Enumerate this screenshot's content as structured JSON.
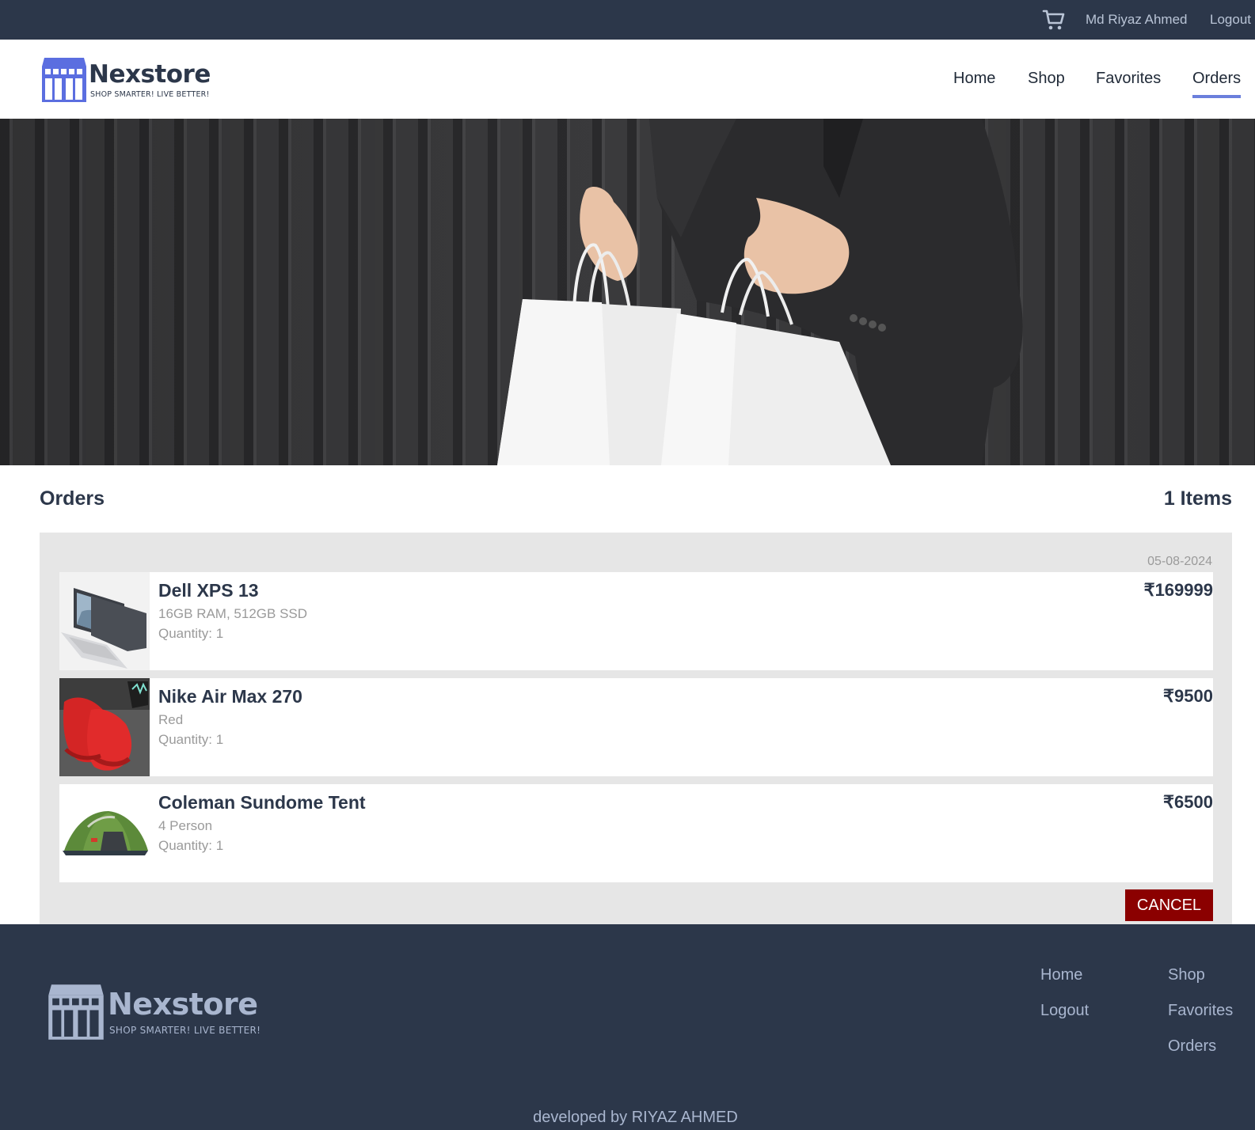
{
  "brand": {
    "name": "Nexstore",
    "tagline": "SHOP SMARTER! LIVE BETTER!"
  },
  "topbar": {
    "cart_icon": "cart-icon",
    "user_name": "Md Riyaz Ahmed",
    "logout_label": "Logout"
  },
  "nav": {
    "items": [
      {
        "label": "Home"
      },
      {
        "label": "Shop"
      },
      {
        "label": "Favorites"
      },
      {
        "label": "Orders",
        "active": true
      }
    ]
  },
  "orders": {
    "title": "Orders",
    "count_label": "1 Items",
    "order": {
      "date": "05-08-2024",
      "items": [
        {
          "name": "Dell XPS 13",
          "variant": "16GB RAM, 512GB SSD",
          "quantity": "Quantity: 1",
          "price": "₹169999",
          "image": "laptop-image"
        },
        {
          "name": "Nike Air Max 270",
          "variant": "Red",
          "quantity": "Quantity: 1",
          "price": "₹9500",
          "image": "red-sneakers-image"
        },
        {
          "name": "Coleman Sundome Tent",
          "variant": "4 Person",
          "quantity": "Quantity: 1",
          "price": "₹6500",
          "image": "tent-image"
        }
      ],
      "cancel_label": "CANCEL"
    }
  },
  "footer": {
    "links_col1": [
      "Home",
      "Logout"
    ],
    "links_col2": [
      "Shop",
      "Favorites",
      "Orders"
    ],
    "credit": "developed by RIYAZ AHMED"
  },
  "colors": {
    "dark": "#2c374a",
    "accent": "#6b7fdc",
    "cancel": "#8b0000",
    "panel": "#e6e6e6",
    "muted": "#9a9a9a"
  }
}
